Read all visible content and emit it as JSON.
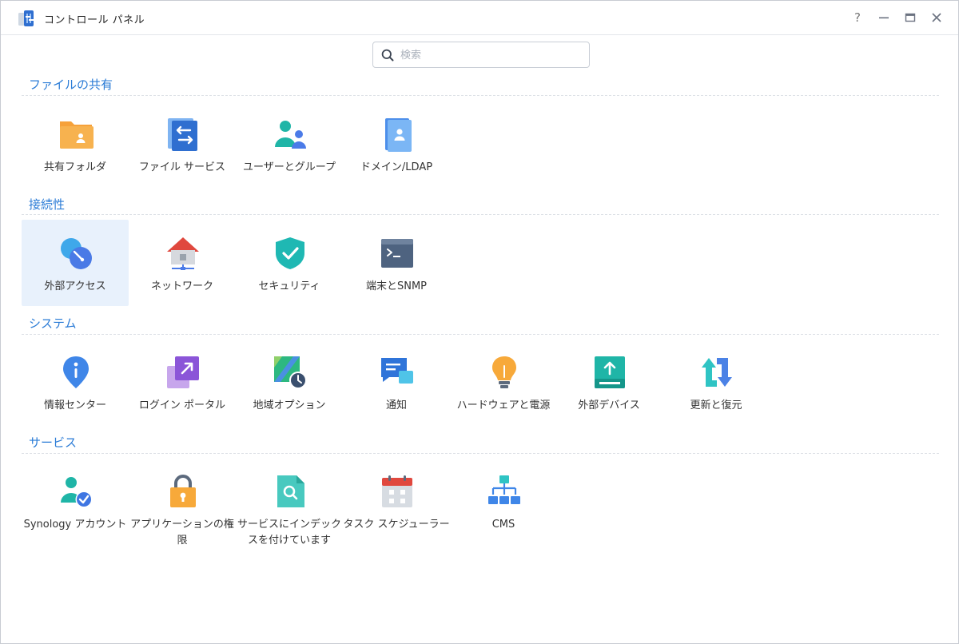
{
  "window": {
    "title": "コントロール パネル"
  },
  "titlebar_buttons": {
    "help": "?",
    "minimize": "minimize",
    "maximize": "maximize",
    "close": "close"
  },
  "search": {
    "placeholder": "検索",
    "value": ""
  },
  "sections": [
    {
      "title": "ファイルの共有",
      "items": [
        {
          "label": "共有フォルダ",
          "icon": "shared-folder-icon"
        },
        {
          "label": "ファイル サービス",
          "icon": "file-services-icon"
        },
        {
          "label": "ユーザーとグループ",
          "icon": "user-group-icon"
        },
        {
          "label": "ドメイン/LDAP",
          "icon": "domain-ldap-icon"
        }
      ]
    },
    {
      "title": "接続性",
      "items": [
        {
          "label": "外部アクセス",
          "icon": "external-access-icon",
          "selected": true
        },
        {
          "label": "ネットワーク",
          "icon": "network-icon"
        },
        {
          "label": "セキュリティ",
          "icon": "security-shield-icon"
        },
        {
          "label": "端末とSNMP",
          "icon": "terminal-icon"
        }
      ]
    },
    {
      "title": "システム",
      "items": [
        {
          "label": "情報センター",
          "icon": "info-center-icon"
        },
        {
          "label": "ログイン ポータル",
          "icon": "login-portal-icon"
        },
        {
          "label": "地域オプション",
          "icon": "regional-options-icon"
        },
        {
          "label": "通知",
          "icon": "notification-icon"
        },
        {
          "label": "ハードウェアと電源",
          "icon": "hardware-power-icon"
        },
        {
          "label": "外部デバイス",
          "icon": "external-devices-icon"
        },
        {
          "label": "更新と復元",
          "icon": "update-restore-icon"
        }
      ]
    },
    {
      "title": "サービス",
      "items": [
        {
          "label": "Synology アカウント",
          "icon": "synology-account-icon"
        },
        {
          "label": "アプリケーションの権限",
          "icon": "application-privileges-icon"
        },
        {
          "label": "サービスにインデックスを付けています",
          "icon": "indexing-service-icon"
        },
        {
          "label": "タスク スケジューラー",
          "icon": "task-scheduler-icon"
        },
        {
          "label": "CMS",
          "icon": "cms-icon"
        }
      ]
    }
  ],
  "colors": {
    "section_title": "#2a7bd6",
    "selected_bg": "#e8f1fc"
  }
}
